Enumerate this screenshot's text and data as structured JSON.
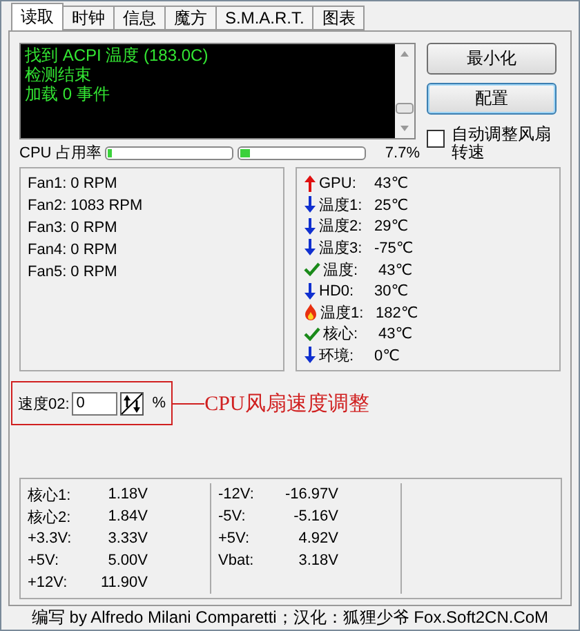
{
  "tabs": [
    {
      "label": "读取",
      "selected": true
    },
    {
      "label": "时钟",
      "selected": false
    },
    {
      "label": "信息",
      "selected": false
    },
    {
      "label": "魔方",
      "selected": false
    },
    {
      "label": "S.M.A.R.T.",
      "selected": false
    },
    {
      "label": "图表",
      "selected": false
    }
  ],
  "log": [
    "找到 ACPI 温度 (183.0C)",
    "检测结束",
    "加载 0 事件"
  ],
  "buttons": [
    {
      "label": "最小化",
      "selected": false
    },
    {
      "label": "配置",
      "selected": true
    }
  ],
  "auto_fan": {
    "label": "自动调整风扇转速",
    "checked": false
  },
  "cpu_usage": {
    "label": "CPU 占用率",
    "bars": [
      {
        "level": 0.03
      },
      {
        "level": 0.08
      }
    ],
    "reading": "7.7%"
  },
  "fans": [
    "Fan1: 0 RPM",
    "Fan2: 1083 RPM",
    "Fan3: 0 RPM",
    "Fan4: 0 RPM",
    "Fan5: 0 RPM"
  ],
  "temperatures": [
    {
      "kind": "up",
      "name": "GPU:",
      "value": "43℃"
    },
    {
      "kind": "down",
      "name": "温度1:",
      "value": "25℃"
    },
    {
      "kind": "down",
      "name": "温度2:",
      "value": "29℃"
    },
    {
      "kind": "down",
      "name": "温度3:",
      "value": "-75℃"
    },
    {
      "kind": "ok",
      "name": "温度:",
      "value": "43℃"
    },
    {
      "kind": "down",
      "name": "HD0:",
      "value": "30℃"
    },
    {
      "kind": "fire",
      "name": "温度1:",
      "value": "182℃"
    },
    {
      "kind": "ok",
      "name": "核心:",
      "value": "43℃"
    },
    {
      "kind": "down",
      "name": "环境:",
      "value": "0℃"
    }
  ],
  "speed": {
    "label": "速度02:",
    "value": "0",
    "unit": "%"
  },
  "annotation": "CPU风扇速度调整",
  "voltages": [
    [
      {
        "name": "核心1:",
        "value": "1.18V"
      },
      {
        "name": "核心2:",
        "value": "1.84V"
      },
      {
        "name": "+3.3V:",
        "value": "3.33V"
      },
      {
        "name": "+5V:",
        "value": "5.00V"
      },
      {
        "name": "+12V:",
        "value": "11.90V"
      }
    ],
    [
      {
        "name": "-12V:",
        "value": "-16.97V"
      },
      {
        "name": "-5V:",
        "value": "-5.16V"
      },
      {
        "name": "+5V:",
        "value": "4.92V"
      },
      {
        "name": "Vbat:",
        "value": "3.18V"
      }
    ]
  ],
  "footer": "编写 by Alfredo Milani Comparetti；汉化：狐狸少爷 Fox.Soft2CN.CoM"
}
